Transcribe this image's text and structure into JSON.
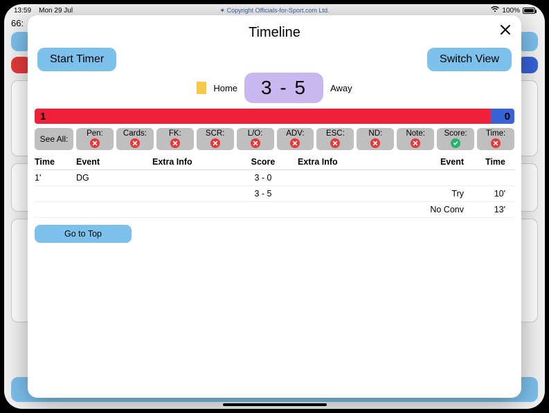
{
  "status": {
    "time": "13:59",
    "date": "Mon 29 Jul",
    "copyright": "Copyright Officials-for-Sport.com Ltd.",
    "battery_pct": "100%"
  },
  "background": {
    "number": "66:"
  },
  "modal": {
    "title": "Timeline",
    "start_timer": "Start Timer",
    "switch_view": "Switch View",
    "home_label": "Home",
    "away_label": "Away",
    "score": "3 - 5",
    "half": {
      "left": "1",
      "right": "0"
    },
    "filters": {
      "see_all": "See All:",
      "items": [
        {
          "label": "Pen:",
          "state": "red"
        },
        {
          "label": "Cards:",
          "state": "red"
        },
        {
          "label": "FK:",
          "state": "red"
        },
        {
          "label": "SCR:",
          "state": "red"
        },
        {
          "label": "L/O:",
          "state": "red"
        },
        {
          "label": "ADV:",
          "state": "red"
        },
        {
          "label": "ESC:",
          "state": "red"
        },
        {
          "label": "ND:",
          "state": "red"
        },
        {
          "label": "Note:",
          "state": "red"
        },
        {
          "label": "Score:",
          "state": "green"
        },
        {
          "label": "Time:",
          "state": "red"
        }
      ]
    },
    "table": {
      "headers": {
        "time_l": "Time",
        "event_l": "Event",
        "extra_l": "Extra Info",
        "score": "Score",
        "extra_r": "Extra Info",
        "event_r": "Event",
        "time_r": "Time"
      },
      "rows": [
        {
          "time_l": "1'",
          "event_l": "DG",
          "extra_l": "",
          "score": "3 - 0",
          "extra_r": "",
          "event_r": "",
          "time_r": ""
        },
        {
          "time_l": "",
          "event_l": "",
          "extra_l": "",
          "score": "3 - 5",
          "extra_r": "",
          "event_r": "Try",
          "time_r": "10'"
        },
        {
          "time_l": "",
          "event_l": "",
          "extra_l": "",
          "score": "",
          "extra_r": "",
          "event_r": "No Conv",
          "time_r": "13'"
        }
      ]
    },
    "go_to_top": "Go to Top"
  }
}
